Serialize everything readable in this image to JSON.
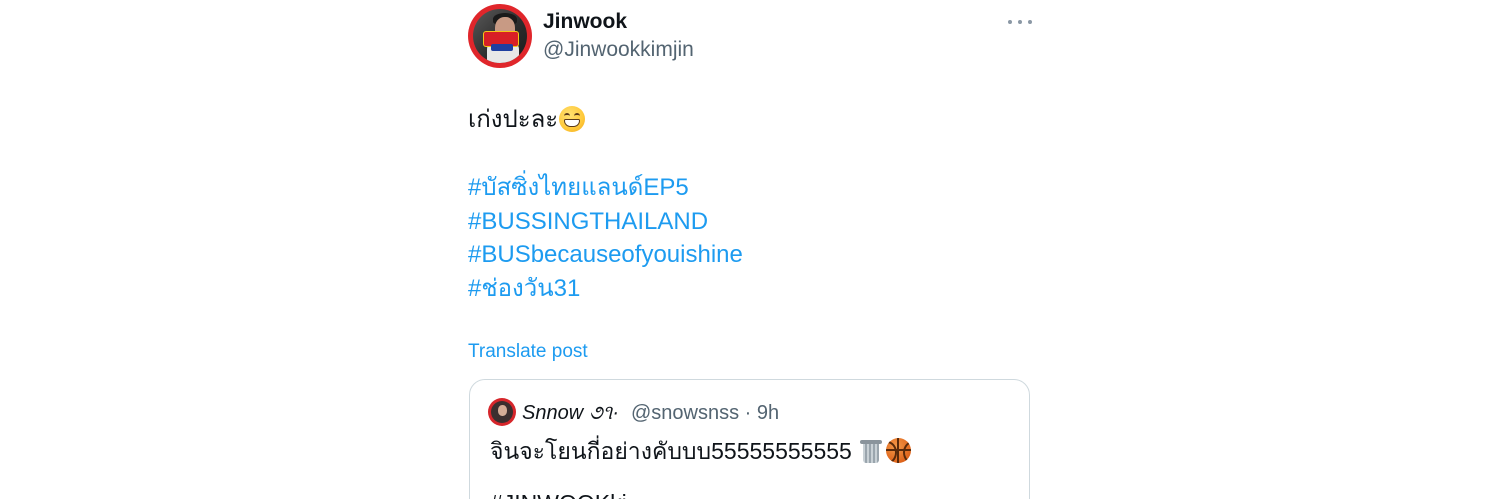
{
  "post": {
    "author": {
      "display_name": "Jinwook",
      "handle": "@Jinwookkimjin",
      "avatar_icon": "profile-photo"
    },
    "more_icon": "more-horizontal-icon",
    "text": "เก่งปะละ",
    "text_emoji": "grinning-face-with-smiling-eyes-emoji",
    "hashtags": [
      "#บัสซิ่งไทยแลนด์EP5",
      "#BUSSINGTHAILAND",
      "#BUSbecauseofyouishine",
      "#ช่องวัน31"
    ],
    "translate_label": "Translate post",
    "colors": {
      "link": "#1d9bf0",
      "secondary_text": "#536471",
      "border": "#cfd9de",
      "avatar_ring": "#e0262b"
    }
  },
  "quoted_post": {
    "display_name": "Snnow ૭૧·",
    "handle_time": "@snowsnss · 9h",
    "text": "จินจะโยนกี่อย่างคับบบ55555555555",
    "emojis": [
      "wastebasket-emoji",
      "basketball-emoji"
    ],
    "text_line2": "#JINWOOKki"
  }
}
